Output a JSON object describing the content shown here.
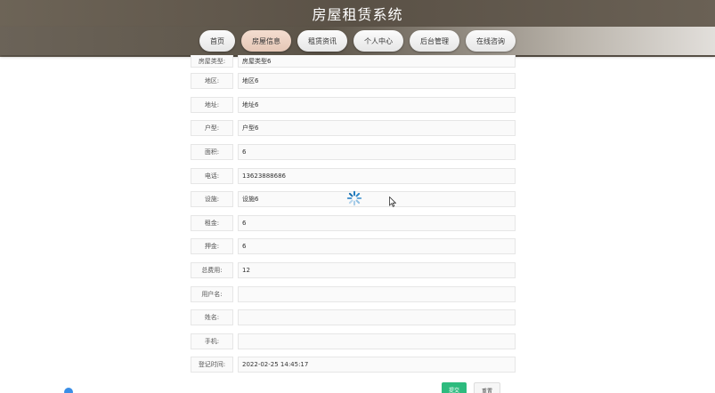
{
  "header": {
    "title": "房屋租赁系统"
  },
  "nav": {
    "items": [
      {
        "label": "首页",
        "name": "nav-home"
      },
      {
        "label": "房屋信息",
        "name": "nav-house-info",
        "active": true
      },
      {
        "label": "租赁资讯",
        "name": "nav-rental-news"
      },
      {
        "label": "个人中心",
        "name": "nav-personal-center"
      },
      {
        "label": "后台管理",
        "name": "nav-admin"
      },
      {
        "label": "在线咨询",
        "name": "nav-online-consult"
      }
    ]
  },
  "form": {
    "rows": [
      {
        "label": "房屋类型:",
        "value": "房屋类型6"
      },
      {
        "label": "地区:",
        "value": "地区6"
      },
      {
        "label": "地址:",
        "value": "地址6"
      },
      {
        "label": "户型:",
        "value": "户型6"
      },
      {
        "label": "面积:",
        "value": "6"
      },
      {
        "label": "电话:",
        "value": "13623888686"
      },
      {
        "label": "设施:",
        "value": "设施6"
      },
      {
        "label": "租金:",
        "value": "6"
      },
      {
        "label": "押金:",
        "value": "6"
      },
      {
        "label": "总费用:",
        "value": "12"
      },
      {
        "label": "用户名:",
        "value": ""
      },
      {
        "label": "姓名:",
        "value": ""
      },
      {
        "label": "手机:",
        "value": ""
      },
      {
        "label": "登记时间:",
        "value": "2022-02-25 14:45:17"
      }
    ]
  },
  "buttons": {
    "submit": "提交",
    "reset": "重置"
  },
  "colors": {
    "submit": "#2dbb7e",
    "nav_active": "#e5c7b6",
    "header": "#5a5146"
  },
  "icons": {
    "spinner": "loading-spinner-icon",
    "cursor": "mouse-cursor-icon"
  }
}
